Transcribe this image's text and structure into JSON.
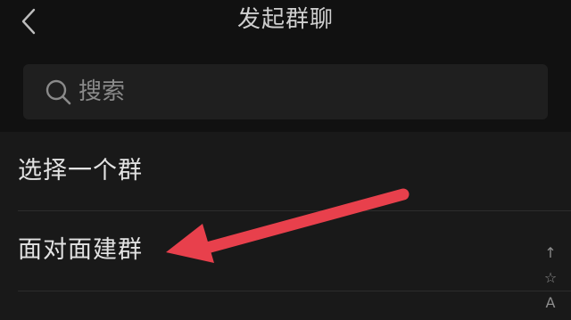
{
  "header": {
    "title": "发起群聊",
    "back_icon": "chevron-left-icon"
  },
  "search": {
    "placeholder": "搜索",
    "icon": "search-icon"
  },
  "list": {
    "items": [
      {
        "label": "选择一个群"
      },
      {
        "label": "面对面建群"
      }
    ]
  },
  "index_bar": {
    "items": [
      "↑",
      "☆",
      "A"
    ]
  },
  "annotation": {
    "arrow_color": "#e8404c",
    "icon": "red-arrow-icon"
  },
  "colors": {
    "background": "#161616",
    "header_bg": "#111111",
    "search_box": "#1f1f1f",
    "text": "#e2e2e2",
    "placeholder": "#8a8a8a"
  }
}
